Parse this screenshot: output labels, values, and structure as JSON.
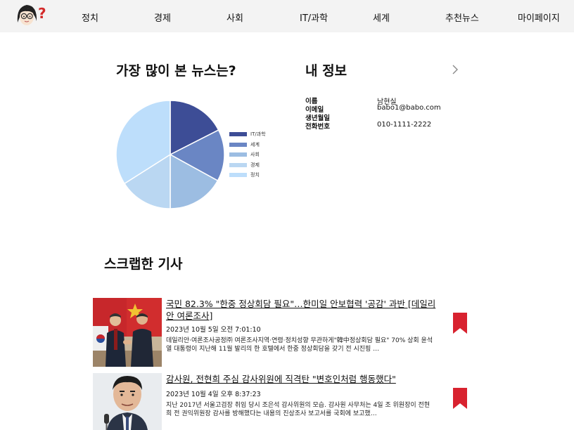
{
  "nav": {
    "items": [
      "정치",
      "경제",
      "사회",
      "IT/과학",
      "세계",
      "추천뉴스",
      "마이페이지"
    ]
  },
  "most_viewed": {
    "title": "가장 많이 본 뉴스는?"
  },
  "chart_data": {
    "type": "pie",
    "title": "",
    "categories": [
      "IT/과학",
      "세계",
      "사회",
      "경제",
      "정치"
    ],
    "values": [
      17.5,
      15.5,
      17,
      16,
      34
    ],
    "colors": [
      "#3d4d96",
      "#6a86c4",
      "#9cbde2",
      "#bad7f2",
      "#bddefb"
    ],
    "legend": "right"
  },
  "my_info": {
    "title": "내 정보",
    "fields": [
      {
        "label": "이름",
        "value": "남현실"
      },
      {
        "label": "이메일",
        "value": "babo1@babo.com"
      },
      {
        "label": "생년월일",
        "value": ""
      },
      {
        "label": "전화번호",
        "value": "010-1111-2222"
      }
    ]
  },
  "scrap": {
    "title": "스크랩한 기사",
    "articles": [
      {
        "title": "국민 82.3% \"한중 정상회담 필요\"…한미일 안보협력 '공감' 과반 [데일리안 여론조사]",
        "date": "2023년 10월 5일 오전 7:01:10",
        "summary": "데일리안·여론조사공정㈜ 여론조사지역·연령·정치성향 무관하게\"韓中정상회담 필요\" 70% 상회 윤석열 대통령이 지난해 11월 발리의 한 호텔에서 한중 정상회담을 갖기 전 시진핑 …"
      },
      {
        "title": "감사원, 전현희 주심 감사위원에 직격탄 \"변호인처럼 행동했다\"",
        "date": "2023년 10월 4일 오후 8:37:23",
        "summary": "지난 2017년 서울고검장 취임 당시 조은석 감사위원의 모습. 감사원 사무처는 4일 조 위원장이 전현희 전 권익위원장 감사를 방해했다는 내용의 진상조사 보고서를 국회에 보고했…"
      }
    ]
  },
  "colors": {
    "bookmark": "#d8222f",
    "nav_bg": "#f3f3f3"
  }
}
